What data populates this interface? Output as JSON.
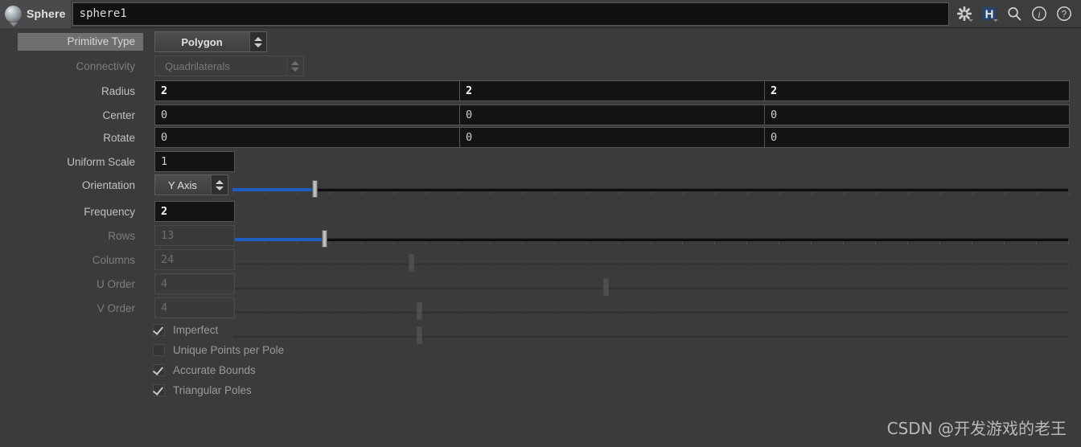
{
  "titlebar": {
    "node_type": "Sphere",
    "node_name": "sphere1",
    "node_icon": "sphere-icon",
    "icons": [
      {
        "name": "gear-icon",
        "glyph": "gear"
      },
      {
        "name": "houdini-h-icon",
        "glyph": "H"
      },
      {
        "name": "search-icon",
        "glyph": "magnifier"
      },
      {
        "name": "info-icon",
        "glyph": "i"
      },
      {
        "name": "help-icon",
        "glyph": "?"
      }
    ]
  },
  "params": {
    "primitive_type": {
      "label": "Primitive Type",
      "value": "Polygon",
      "enabled": true,
      "highlighted": true
    },
    "connectivity": {
      "label": "Connectivity",
      "value": "Quadrilaterals",
      "enabled": false
    },
    "radius": {
      "label": "Radius",
      "values": [
        "2",
        "2",
        "2"
      ],
      "enabled": true,
      "modified": true
    },
    "center": {
      "label": "Center",
      "values": [
        "0",
        "0",
        "0"
      ],
      "enabled": true,
      "modified": false
    },
    "rotate": {
      "label": "Rotate",
      "values": [
        "0",
        "0",
        "0"
      ],
      "enabled": true,
      "modified": false
    },
    "uniform_scale": {
      "label": "Uniform Scale",
      "value": "1",
      "enabled": true,
      "slider_percent": 9.9
    },
    "orientation": {
      "label": "Orientation",
      "value": "Y Axis",
      "enabled": true
    },
    "frequency": {
      "label": "Frequency",
      "value": "2",
      "enabled": true,
      "modified": true,
      "slider_percent": 11.1
    },
    "rows": {
      "label": "Rows",
      "value": "13",
      "enabled": false,
      "slider_percent": 21.5
    },
    "columns": {
      "label": "Columns",
      "value": "24",
      "enabled": false,
      "slider_percent": 44.8
    },
    "u_order": {
      "label": "U Order",
      "value": "4",
      "enabled": false,
      "slider_percent": 22.4
    },
    "v_order": {
      "label": "V Order",
      "value": "4",
      "enabled": false,
      "slider_percent": 22.4
    }
  },
  "toggles": [
    {
      "label": "Imperfect",
      "checked": true
    },
    {
      "label": "Unique Points per Pole",
      "checked": false
    },
    {
      "label": "Accurate Bounds",
      "checked": true
    },
    {
      "label": "Triangular Poles",
      "checked": true
    }
  ],
  "watermark": {
    "text": "CSDN @开发游戏的老王"
  },
  "colors": {
    "background": "#3b3b3b",
    "slider_accent": "#1f5fc4",
    "field_background": "#131313",
    "label_text": "#c0c0c0",
    "disabled_text": "#7e7e7e"
  }
}
